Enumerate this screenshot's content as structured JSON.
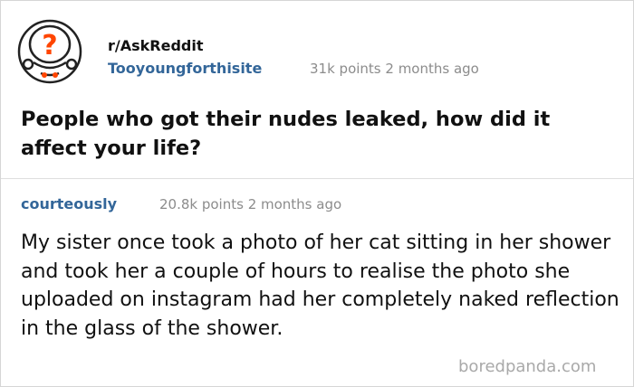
{
  "post": {
    "subreddit": "r/AskReddit",
    "author": "Tooyoungforthisite",
    "meta": "31k points 2 months ago",
    "title": "People who got their nudes leaked, how did it affect your life?",
    "avatar_icon": "askreddit-snoo-question-icon"
  },
  "comment": {
    "author": "courteously",
    "meta": "20.8k points 2 months ago",
    "body": "My sister once took a photo of her cat sitting in her shower and took her a couple of hours to realise the photo she uploaded on instagram had her completely naked reflection in the glass of the shower."
  },
  "watermark": "boredpanda.com",
  "colors": {
    "username": "#336699",
    "meta": "#8c8c8c",
    "text": "#111111",
    "accent_orange": "#ff4500",
    "divider": "#dedede"
  }
}
